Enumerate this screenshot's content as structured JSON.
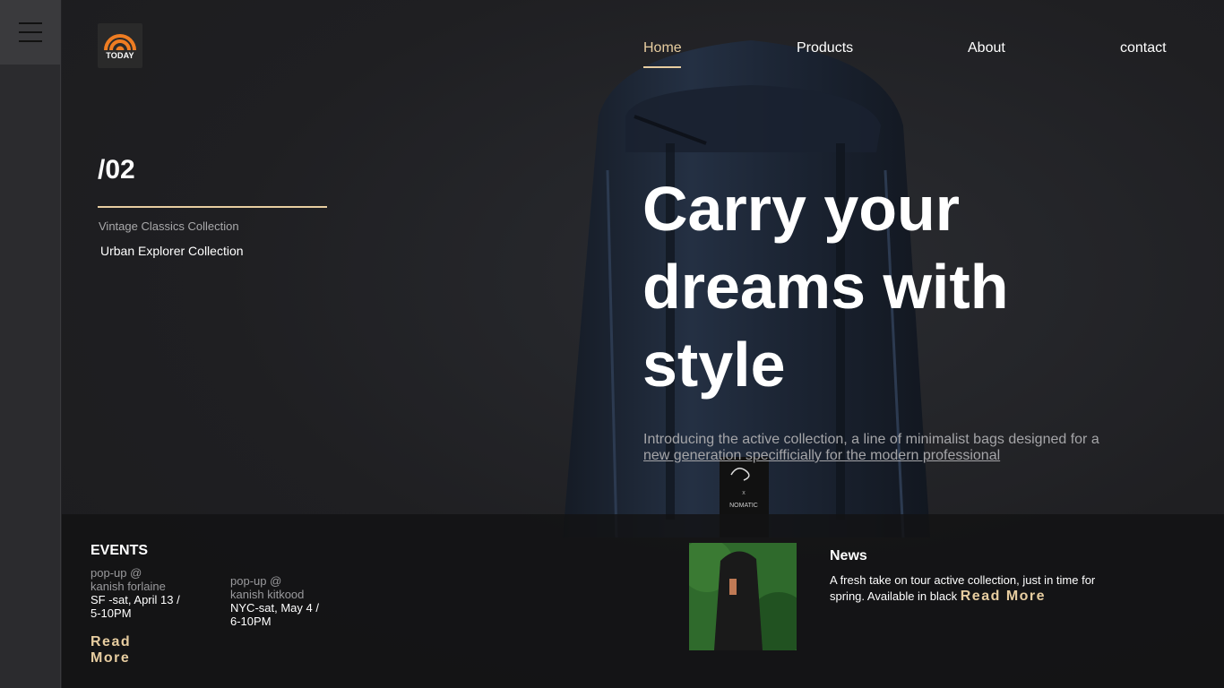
{
  "logo": {
    "text": "TODAY"
  },
  "nav": {
    "items": [
      {
        "label": "Home"
      },
      {
        "label": "Products"
      },
      {
        "label": "About"
      },
      {
        "label": "contact"
      }
    ],
    "active": "Home"
  },
  "collections": {
    "slide_number": "/02",
    "items": [
      "Vintage Classics Collection",
      "Urban Explorer Collection"
    ]
  },
  "hero": {
    "title": "Carry your dreams with style",
    "subtitle_plain": "Introducing the active collection, a line of minimalist bags designed for a",
    "subtitle_underlined": "new generation specifficially for the modern professional",
    "bag_label": "NOMATIC"
  },
  "events": {
    "title": "EVENTS",
    "items": [
      {
        "venue_line1": "pop-up @",
        "venue_line2": "kanish forlaine",
        "when": "SF -sat, April 13 / 5-10PM"
      },
      {
        "venue_line1": "pop-up @",
        "venue_line2": "kanish kitkood",
        "when": "NYC-sat, May 4 / 6-10PM"
      }
    ],
    "read_more": "Read More"
  },
  "news": {
    "title": "News",
    "text": "A fresh take on tour active collection, just in time for spring. Available in black",
    "read_more": "Read More"
  },
  "colors": {
    "accent": "#e7cda0",
    "background": "#222225",
    "bottom_bar": "#121213"
  }
}
